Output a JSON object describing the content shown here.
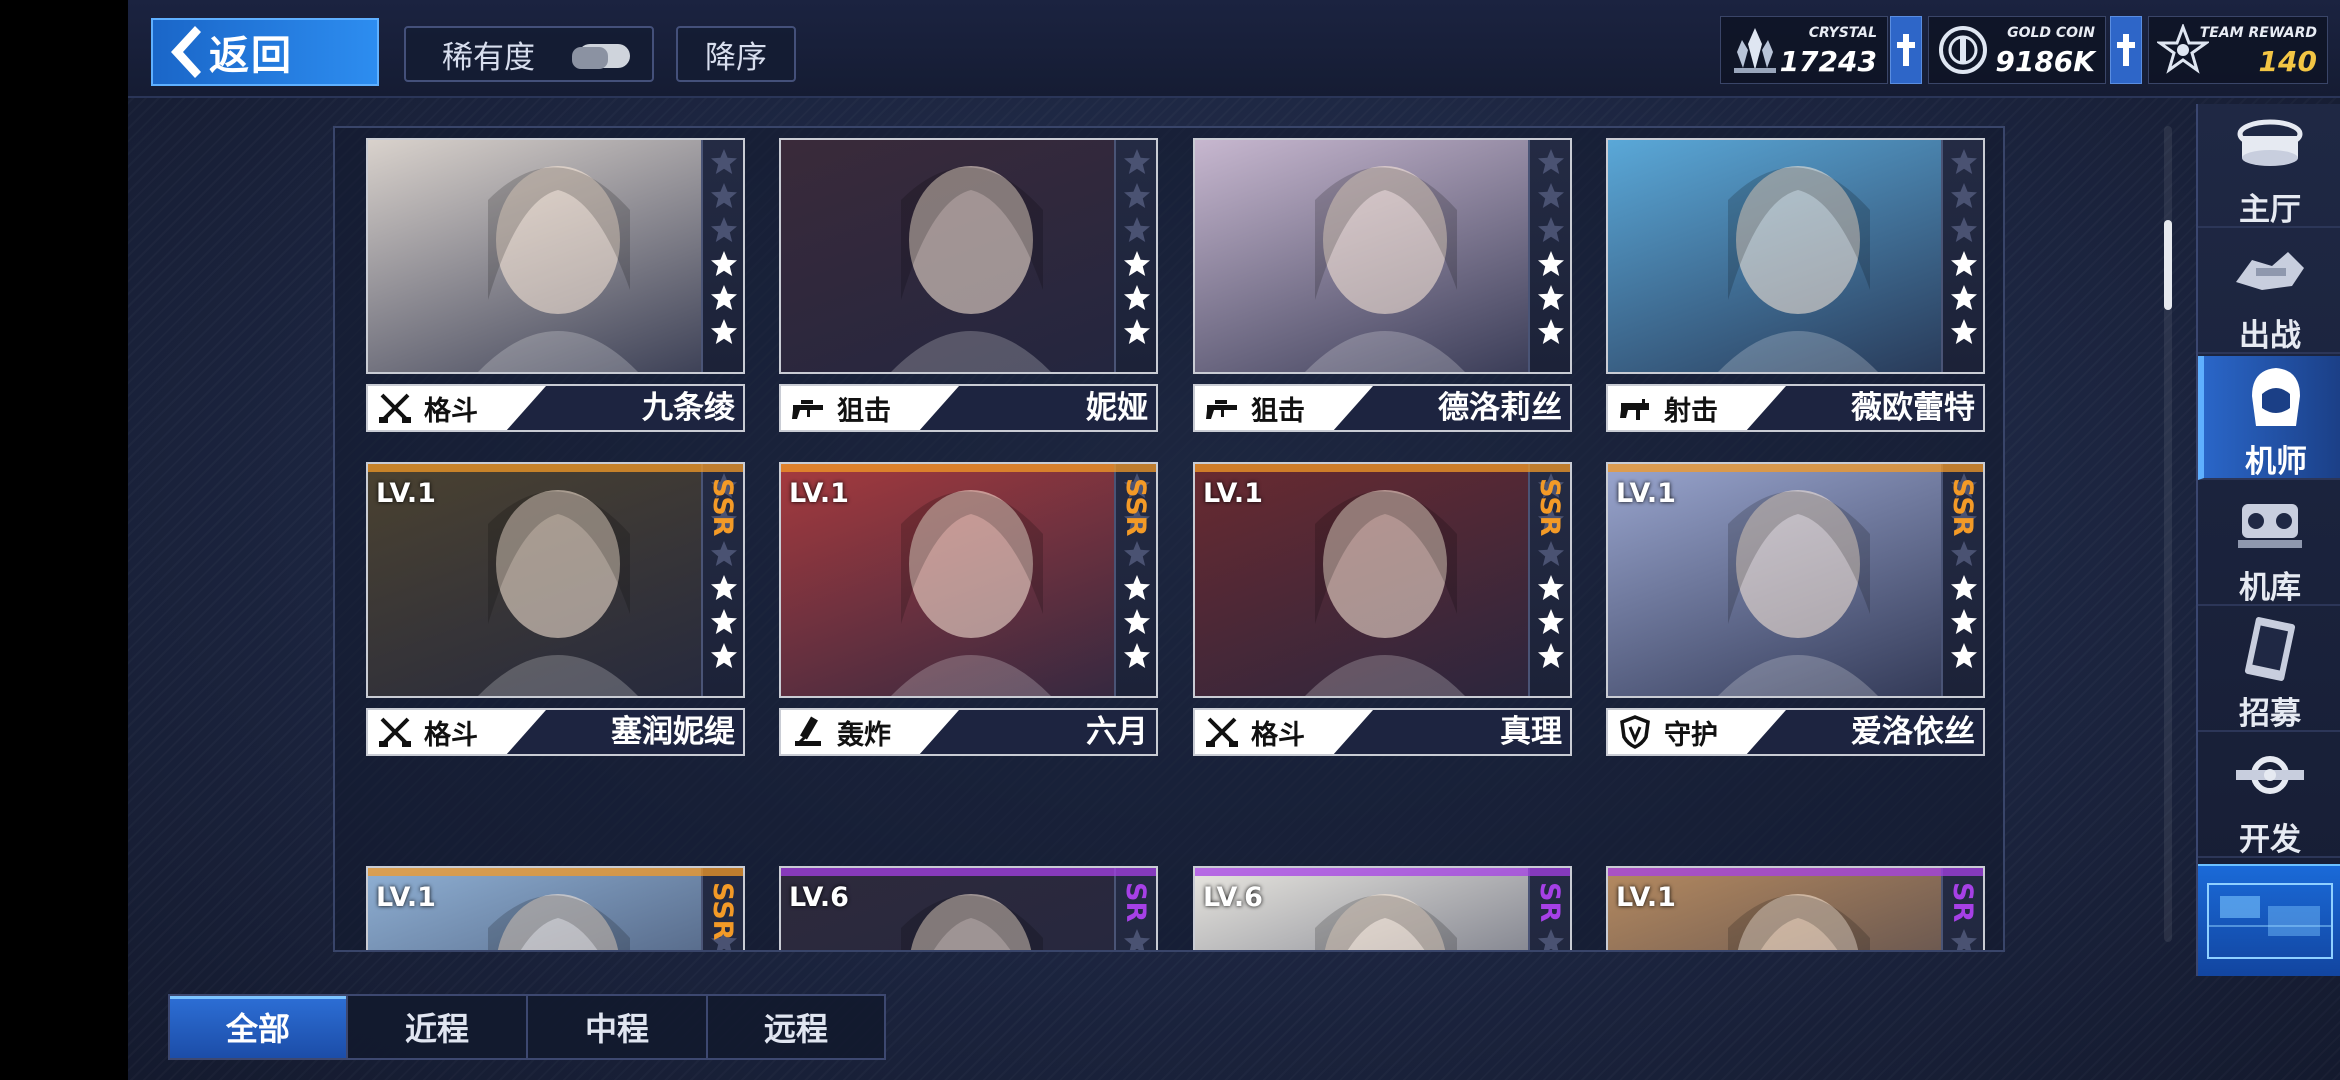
{
  "header": {
    "back_label": "返回",
    "rarity_label": "稀有度",
    "order_label": "降序",
    "crystal_caption": "CRYSTAL",
    "crystal_value": "17243",
    "gold_caption": "GOLD COIN",
    "gold_value": "9186K",
    "team_caption": "TEAM REWARD",
    "team_value": "140"
  },
  "pilots": [
    {
      "name": "九条绫",
      "role": "格斗",
      "role_icon": "crossed-swords-icon",
      "level": "",
      "rarity": "",
      "stars": 3,
      "bg": "#d9d2cc"
    },
    {
      "name": "妮娅",
      "role": "狙击",
      "role_icon": "sniper-rifle-icon",
      "level": "",
      "rarity": "",
      "stars": 3,
      "bg": "#3a2a3a"
    },
    {
      "name": "德洛莉丝",
      "role": "狙击",
      "role_icon": "sniper-rifle-icon",
      "level": "",
      "rarity": "",
      "stars": 3,
      "bg": "#c7b7cf"
    },
    {
      "name": "薇欧蕾特",
      "role": "射击",
      "role_icon": "assault-rifle-icon",
      "level": "",
      "rarity": "",
      "stars": 3,
      "bg": "#5aa8d8"
    },
    {
      "name": "塞润妮缇",
      "role": "格斗",
      "role_icon": "crossed-swords-icon",
      "level": "LV.1",
      "rarity": "SSR",
      "stars": 3,
      "bg": "#4b4230"
    },
    {
      "name": "六月",
      "role": "轰炸",
      "role_icon": "mortar-icon",
      "level": "LV.1",
      "rarity": "SSR",
      "stars": 3,
      "bg": "#a63a3e"
    },
    {
      "name": "真理",
      "role": "格斗",
      "role_icon": "crossed-swords-icon",
      "level": "LV.1",
      "rarity": "SSR",
      "stars": 3,
      "bg": "#6a2a30"
    },
    {
      "name": "爱洛依丝",
      "role": "守护",
      "role_icon": "shield-icon",
      "level": "LV.1",
      "rarity": "SSR",
      "stars": 3,
      "bg": "#9aa6cf"
    },
    {
      "name": "",
      "role": "",
      "role_icon": "",
      "level": "LV.1",
      "rarity": "SSR",
      "stars": 0,
      "bg": "#8fb0d4"
    },
    {
      "name": "",
      "role": "",
      "role_icon": "",
      "level": "LV.6",
      "rarity": "SR",
      "stars": 0,
      "bg": "#2e2a3c"
    },
    {
      "name": "",
      "role": "",
      "role_icon": "",
      "level": "LV.6",
      "rarity": "SR",
      "stars": 0,
      "bg": "#e8e6e0"
    },
    {
      "name": "",
      "role": "",
      "role_icon": "",
      "level": "LV.1",
      "rarity": "SR",
      "stars": 0,
      "bg": "#b58a60"
    }
  ],
  "nav": [
    {
      "label": "主厅",
      "icon": "lobby-icon"
    },
    {
      "label": "出战",
      "icon": "sortie-icon"
    },
    {
      "label": "机师",
      "icon": "pilot-icon"
    },
    {
      "label": "机库",
      "icon": "hangar-icon"
    },
    {
      "label": "招募",
      "icon": "recruit-icon"
    },
    {
      "label": "开发",
      "icon": "develop-icon"
    }
  ],
  "nav_active": "机师",
  "tabs": [
    "全部",
    "近程",
    "中程",
    "远程"
  ],
  "tab_active": "全部",
  "colors": {
    "accent": "#2d8df0",
    "ssr": "#f39a27",
    "sr": "#a640e6"
  }
}
